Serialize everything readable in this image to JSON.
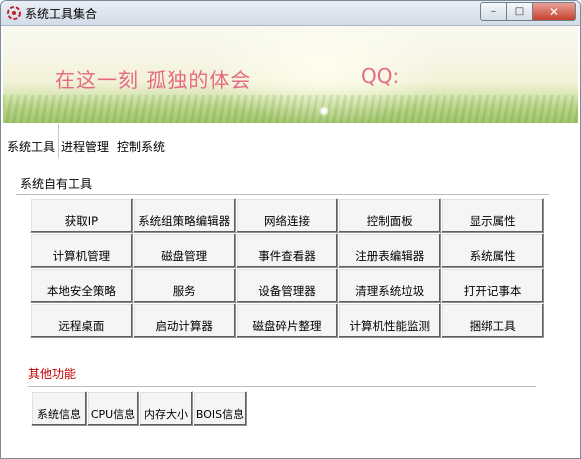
{
  "window": {
    "title": "系统工具集合"
  },
  "banner": {
    "slogan": "在这一刻 孤独的体会",
    "qq": "QQ:"
  },
  "tabs": [
    "系统工具",
    "进程管理",
    "控制系统"
  ],
  "groups": {
    "builtin": "系统自有工具",
    "other": "其他功能"
  },
  "tools": [
    "获取IP",
    "系统组策略编辑器",
    "网络连接",
    "控制面板",
    "显示属性",
    "计算机管理",
    "磁盘管理",
    "事件查看器",
    "注册表编辑器",
    "系统属性",
    "本地安全策略",
    "服务",
    "设备管理器",
    "清理系统垃圾",
    "打开记事本",
    "远程桌面",
    "启动计算器",
    "磁盘碎片整理",
    "计算机性能监测",
    "捆绑工具"
  ],
  "other_tools": [
    "系统信息",
    "CPU信息",
    "内存大小",
    "BOIS信息"
  ],
  "colors": {
    "slogan": "#e46a85",
    "other_label": "#c00000"
  }
}
